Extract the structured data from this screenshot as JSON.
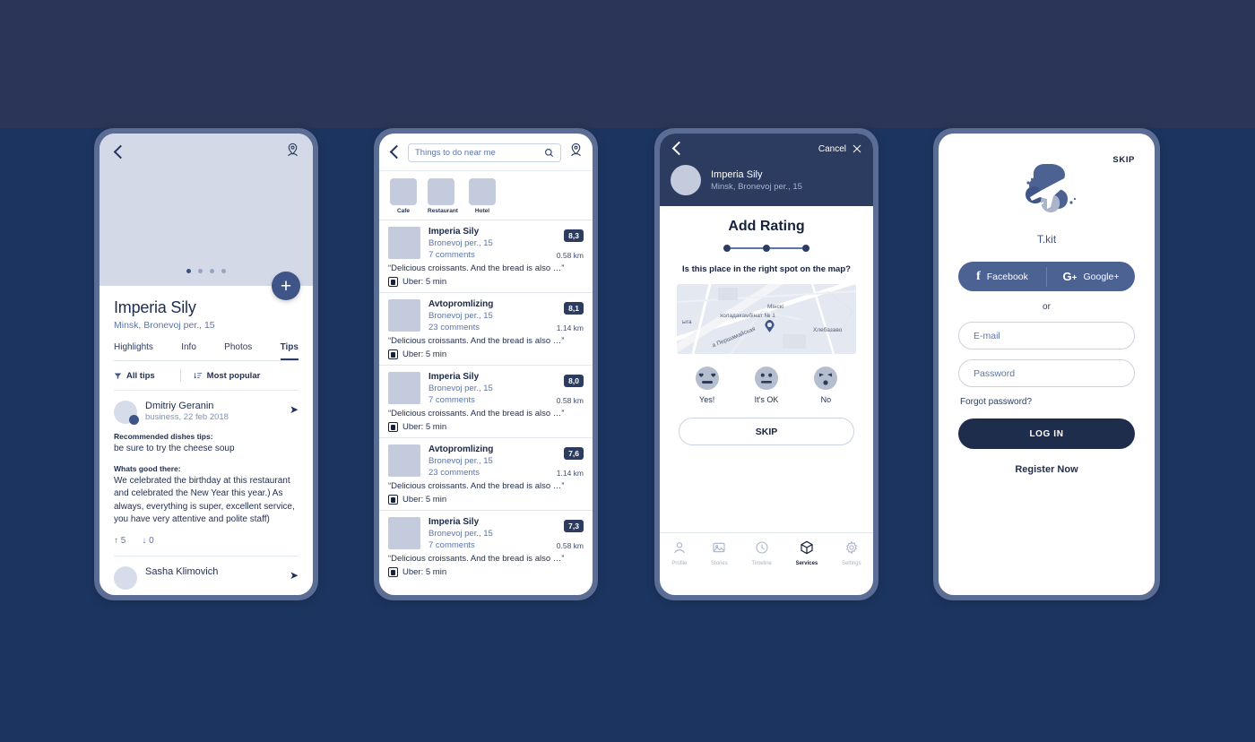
{
  "theme": {
    "bg_top": "#2a3557",
    "bg_bottom": "#1c3560",
    "frame": "#5b6d94",
    "navy": "#2c3c60",
    "navy_dark": "#1f2d4d",
    "accent_blue": "#4c6293",
    "muted_blue": "#5b76ab",
    "placeholder_gray": "#c3cbdd"
  },
  "phone1": {
    "name": "place-detail",
    "icons": {
      "back": "back-chevron-icon",
      "map": "map-pin-person-icon",
      "add": "add-plus-icon"
    },
    "carousel_dots": 4,
    "carousel_active": 0,
    "fab_label": "+",
    "title": "Imperia Sily",
    "subtitle": "Minsk, Bronevoj per., 15",
    "tabs": [
      {
        "label": "Highlights",
        "active": false
      },
      {
        "label": "Info",
        "active": false
      },
      {
        "label": "Photos",
        "active": false
      },
      {
        "label": "Tips",
        "active": true
      }
    ],
    "filters": {
      "left_label": "All tips",
      "left_icon": "funnel-icon",
      "right_label": "Most popular",
      "right_icon": "sort-icon"
    },
    "tips": [
      {
        "author": "Dmitriy Geranin",
        "meta": "business, 22 feb 2018",
        "section1_label": "Recommended dishes tips:",
        "section1_text": "be sure to try the cheese soup",
        "section2_label": "Whats good there:",
        "section2_text": "We celebrated the birthday at this restaurant and celebrated the New Year this year.) As always, everything is super, excellent service, you have very attentive and polite staff)",
        "upvotes": "5",
        "downvotes": "0"
      },
      {
        "author": "Sasha Klimovich"
      }
    ]
  },
  "phone2": {
    "name": "search-results",
    "search": {
      "placeholder": "Things to do near me",
      "icon": "search-icon"
    },
    "icons": {
      "back": "back-chevron-icon",
      "map": "map-pin-person-icon"
    },
    "categories": [
      {
        "label": "Cafe"
      },
      {
        "label": "Restaurant"
      },
      {
        "label": "Hotel"
      }
    ],
    "results": [
      {
        "name": "Imperia Sily",
        "address": "Bronevoj per., 15",
        "comments": "7 comments",
        "rating": "8,3",
        "distance": "0.58 km",
        "quote": "“Delicious croissants. And the bread is also …”",
        "transit": "Uber: 5 min"
      },
      {
        "name": "Avtopromlizing",
        "address": "Bronevoj per., 15",
        "comments": "23 comments",
        "rating": "8,1",
        "distance": "1.14 km",
        "quote": "“Delicious croissants. And the bread is also …”",
        "transit": "Uber: 5 min"
      },
      {
        "name": "Imperia Sily",
        "address": "Bronevoj per., 15",
        "comments": "7 comments",
        "rating": "8,0",
        "distance": "0.58 km",
        "quote": "“Delicious croissants. And the bread is also …”",
        "transit": "Uber: 5 min"
      },
      {
        "name": "Avtopromlizing",
        "address": "Bronevoj per., 15",
        "comments": "23 comments",
        "rating": "7,6",
        "distance": "1.14 km",
        "quote": "“Delicious croissants. And the bread is also …”",
        "transit": "Uber: 5 min"
      },
      {
        "name": "Imperia Sily",
        "address": "Bronevoj per., 15",
        "comments": "7 comments",
        "rating": "7,3",
        "distance": "0.58 km",
        "quote": "“Delicious croissants. And the bread is also …”",
        "transit": "Uber: 5 min"
      }
    ]
  },
  "phone3": {
    "name": "add-rating",
    "icons": {
      "back": "back-chevron-icon",
      "close": "close-x-icon"
    },
    "cancel_label": "Cancel",
    "place_name": "Imperia Sily",
    "place_address": "Minsk, Bronevoj per., 15",
    "title": "Add Rating",
    "steps_total": 3,
    "steps_current": 1,
    "question": "Is this place in the right spot on the map?",
    "map_labels": [
      {
        "text": "Мінскі"
      },
      {
        "text": "холадакамбінат № 1"
      },
      {
        "text": "а Першамайская"
      },
      {
        "text": "Хлебазаво"
      },
      {
        "text": "ыга"
      }
    ],
    "options": [
      {
        "label": "Yes!",
        "icon": "heart-eyes-emoji"
      },
      {
        "label": "It's OK",
        "icon": "neutral-face-emoji"
      },
      {
        "label": "No",
        "icon": "sad-face-emoji"
      }
    ],
    "skip_label": "SKIP",
    "nav": [
      {
        "label": "Profile",
        "icon": "person-icon",
        "active": false
      },
      {
        "label": "Stories",
        "icon": "photo-icon",
        "active": false
      },
      {
        "label": "Timeline",
        "icon": "clock-icon",
        "active": false
      },
      {
        "label": "Services",
        "icon": "box-icon",
        "active": true
      },
      {
        "label": "Settings",
        "icon": "gear-icon",
        "active": false
      }
    ]
  },
  "phone4": {
    "name": "login",
    "skip_label": "SKIP",
    "brand_name": "T.kit",
    "brand_icon": "airplane-logo-icon",
    "social": [
      {
        "label": "Facebook",
        "icon": "facebook-icon"
      },
      {
        "label": "Google+",
        "icon": "google-plus-icon"
      }
    ],
    "or_label": "or",
    "email_placeholder": "E-mail",
    "password_placeholder": "Password",
    "forgot_label": "Forgot password?",
    "login_label": "LOG IN",
    "register_label": "Register Now"
  }
}
